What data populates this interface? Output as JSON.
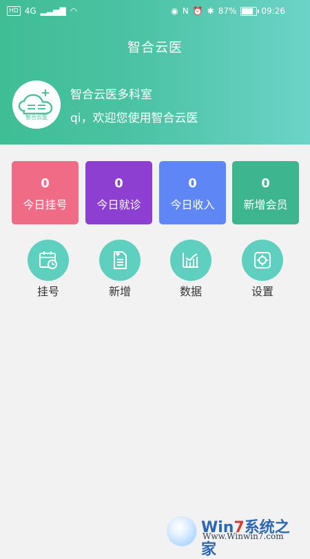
{
  "status_bar": {
    "left_badges": [
      "HD",
      "4G"
    ],
    "battery_percent": "87%",
    "time": "09:26"
  },
  "app": {
    "title": "智合云医"
  },
  "profile": {
    "logo_text": "智合云医",
    "clinic_name": "智合云医多科室",
    "welcome": "qi，欢迎您使用智合云医"
  },
  "stats": [
    {
      "value": "0",
      "label": "今日挂号",
      "color": "#f06b86"
    },
    {
      "value": "0",
      "label": "今日就诊",
      "color": "#8c3fd1"
    },
    {
      "value": "0",
      "label": "今日收入",
      "color": "#5f86f5"
    },
    {
      "value": "0",
      "label": "新增会员",
      "color": "#3db58f"
    }
  ],
  "features": [
    {
      "label": "挂号",
      "icon": "calendar-icon"
    },
    {
      "label": "新增",
      "icon": "add-document-icon"
    },
    {
      "label": "数据",
      "icon": "chart-icon"
    },
    {
      "label": "设置",
      "icon": "settings-icon"
    }
  ],
  "watermark": {
    "brand_prefix": "Win",
    "brand_number": "7",
    "brand_suffix": "系统之家",
    "url": "Www.Winwin7.com"
  },
  "colors": {
    "header_start": "#3fbd95",
    "header_end": "#6cd3c8",
    "feature_circle": "#5fd0c0"
  }
}
